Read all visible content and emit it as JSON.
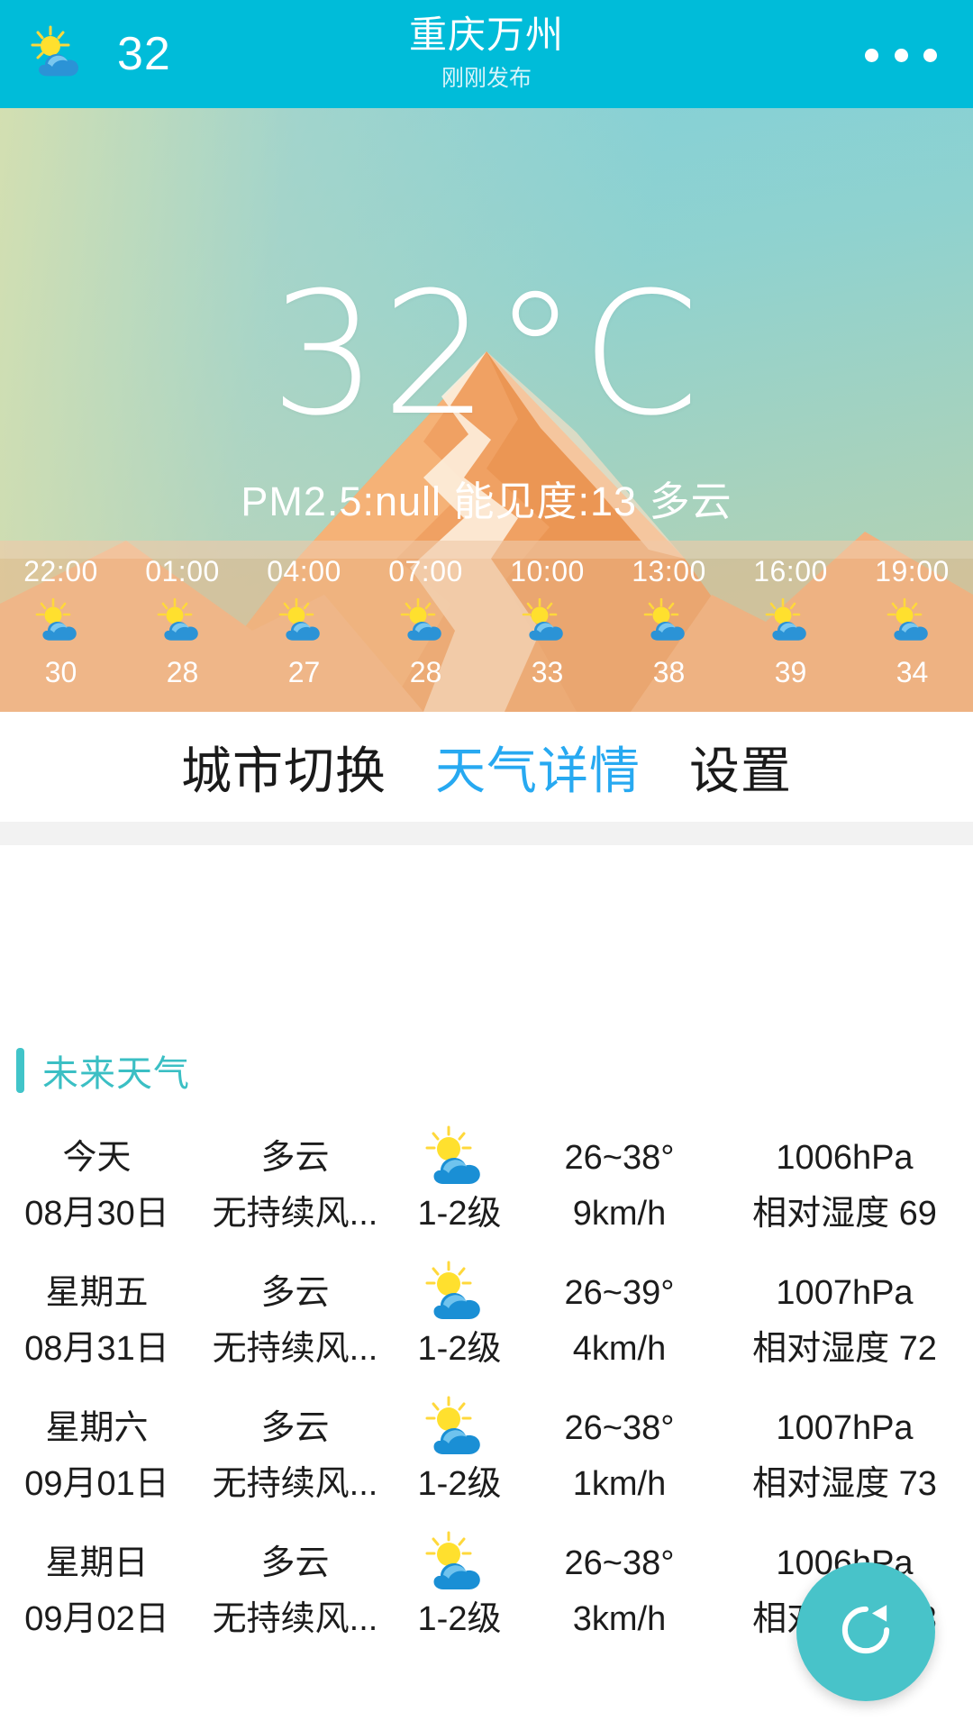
{
  "header": {
    "icon": "partly-cloudy-icon",
    "temp": "32",
    "city": "重庆万州",
    "subtitle": "刚刚发布",
    "menu_icon": "overflow-menu-icon",
    "bg_color": "#00bcd9"
  },
  "hero": {
    "temperature": "32°C",
    "meta": "PM2.5:null  能见度:13  多云",
    "pm25": "null",
    "visibility": "13",
    "condition": "多云"
  },
  "hourly": [
    {
      "time": "22:00",
      "icon": "partly-cloudy-icon",
      "temp": "30"
    },
    {
      "time": "01:00",
      "icon": "partly-cloudy-icon",
      "temp": "28"
    },
    {
      "time": "04:00",
      "icon": "partly-cloudy-icon",
      "temp": "27"
    },
    {
      "time": "07:00",
      "icon": "partly-cloudy-icon",
      "temp": "28"
    },
    {
      "time": "10:00",
      "icon": "partly-cloudy-icon",
      "temp": "33"
    },
    {
      "time": "13:00",
      "icon": "partly-cloudy-icon",
      "temp": "38"
    },
    {
      "time": "16:00",
      "icon": "partly-cloudy-icon",
      "temp": "39"
    },
    {
      "time": "19:00",
      "icon": "partly-cloudy-icon",
      "temp": "34"
    }
  ],
  "tabs": [
    {
      "label": "城市切换",
      "active": false
    },
    {
      "label": "天气详情",
      "active": true
    },
    {
      "label": "设置",
      "active": false
    }
  ],
  "section": {
    "title": "未来天气",
    "accent_color": "#3bbfc4"
  },
  "forecast": [
    {
      "day": "今天",
      "date": "08月30日",
      "condition": "多云",
      "wind": "无持续风...",
      "icon": "partly-cloudy-icon",
      "wind_level": "1-2级",
      "temp_range": "26~38°",
      "wind_speed": "9km/h",
      "pressure": "1006hPa",
      "humidity": "相对湿度 69"
    },
    {
      "day": "星期五",
      "date": "08月31日",
      "condition": "多云",
      "wind": "无持续风...",
      "icon": "partly-cloudy-icon",
      "wind_level": "1-2级",
      "temp_range": "26~39°",
      "wind_speed": "4km/h",
      "pressure": "1007hPa",
      "humidity": "相对湿度 72"
    },
    {
      "day": "星期六",
      "date": "09月01日",
      "condition": "多云",
      "wind": "无持续风...",
      "icon": "partly-cloudy-icon",
      "wind_level": "1-2级",
      "temp_range": "26~38°",
      "wind_speed": "1km/h",
      "pressure": "1007hPa",
      "humidity": "相对湿度 73"
    },
    {
      "day": "星期日",
      "date": "09月02日",
      "condition": "多云",
      "wind": "无持续风...",
      "icon": "partly-cloudy-icon",
      "wind_level": "1-2级",
      "temp_range": "26~38°",
      "wind_speed": "3km/h",
      "pressure": "1006hPa",
      "humidity": "相对湿度 73"
    }
  ],
  "fab": {
    "icon": "refresh-icon",
    "color": "#48c3c9"
  }
}
